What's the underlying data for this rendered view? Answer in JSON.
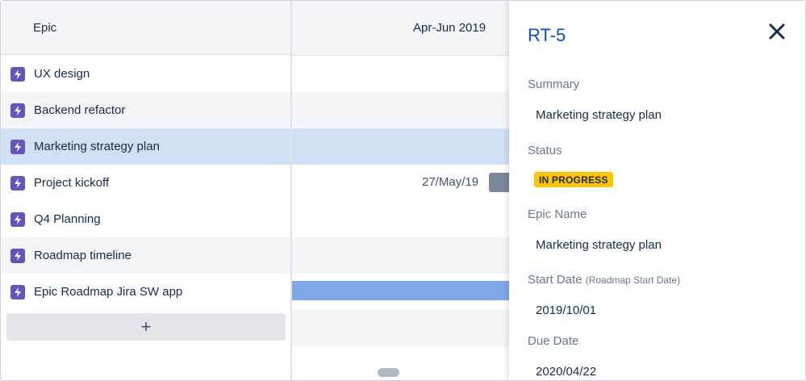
{
  "list": {
    "header": "Epic",
    "items": [
      {
        "label": "UX design"
      },
      {
        "label": "Backend refactor"
      },
      {
        "label": "Marketing strategy plan"
      },
      {
        "label": "Project kickoff"
      },
      {
        "label": "Q4 Planning"
      },
      {
        "label": "Roadmap timeline"
      },
      {
        "label": "Epic Roadmap Jira SW app"
      }
    ],
    "add_label": "+"
  },
  "timeline": {
    "period_label": "Apr-Jun 2019",
    "date_label": "27/May/19"
  },
  "panel": {
    "issue_key": "RT-5",
    "summary_label": "Summary",
    "summary_value": "Marketing strategy plan",
    "status_label": "Status",
    "status_value": "IN PROGRESS",
    "epic_name_label": "Epic Name",
    "epic_name_value": "Marketing strategy plan",
    "start_date_label": "Start Date",
    "start_date_hint": "(Roadmap Start Date)",
    "start_date_value": "2019/10/01",
    "due_date_label": "Due Date",
    "due_date_value": "2020/04/22"
  },
  "colors": {
    "epic_icon": "#6554c0",
    "selected_row": "#cfe1f3",
    "striped_row": "#f4f5f7",
    "link_blue": "#0052cc",
    "status_yellow": "#ffc400",
    "timeline_bar": "#7fa9e4"
  },
  "icons": {
    "epic": "lightning-bolt-icon",
    "close": "close-icon",
    "add": "plus-icon"
  }
}
